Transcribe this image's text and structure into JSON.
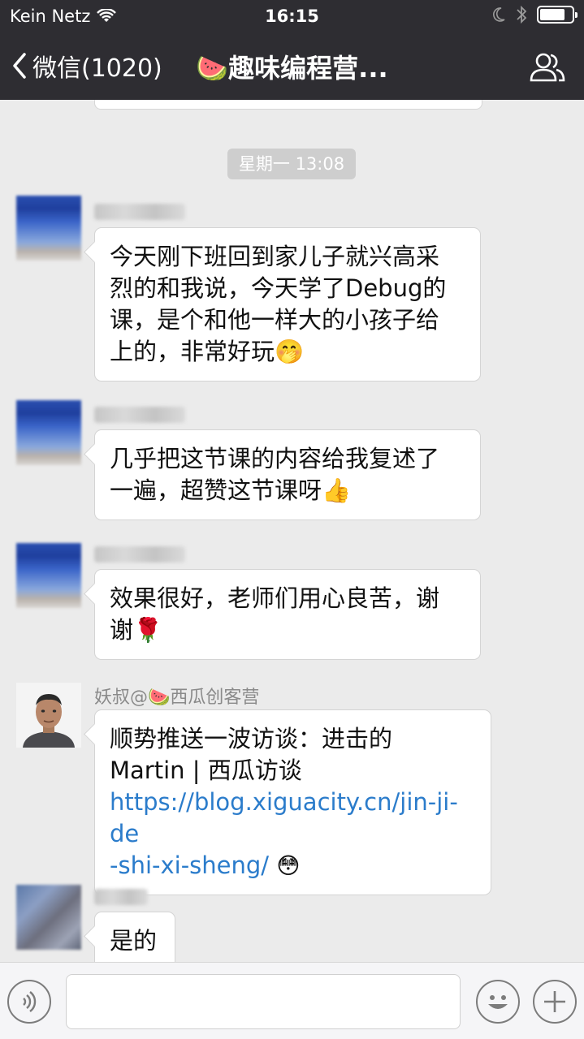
{
  "status_bar": {
    "carrier": "Kein Netz",
    "time": "16:15"
  },
  "nav": {
    "back_label": "微信(1020)",
    "title": "🍉趣味编程营..."
  },
  "chat": {
    "timestamp": "星期一 13:08",
    "messages": [
      {
        "avatar": "pixelated-avatar",
        "sender_blurred": true,
        "lines": [
          "今天刚下班回到家儿子就兴高采",
          "烈的和我说，今天学了Debug的",
          "课，是个和他一样大的小孩子给",
          "上的，非常好玩🤭"
        ]
      },
      {
        "avatar": "pixelated-avatar",
        "sender_blurred": true,
        "lines": [
          "几乎把这节课的内容给我复述了",
          "一遍，超赞这节课呀👍"
        ]
      },
      {
        "avatar": "pixelated-avatar",
        "sender_blurred": true,
        "lines": [
          "效果很好，老师们用心良苦，谢",
          "谢🌹"
        ]
      },
      {
        "avatar": "person-avatar",
        "sender": "妖叔@🍉西瓜创客营",
        "lines": [
          "顺势推送一波访谈：进击的",
          "Martin | 西瓜访谈"
        ],
        "link_lines": [
          "https://blog.xiguacity.cn/jin-ji-de",
          "-shi-xi-sheng/"
        ],
        "link_suffix": "😳"
      },
      {
        "avatar": "pixelated-avatar",
        "sender_blurred": true,
        "lines": [
          "是的"
        ]
      }
    ]
  },
  "input_bar": {
    "voice_icon": "voice-icon",
    "emoji_icon": "emoji-icon",
    "plus_icon": "plus-icon",
    "text_value": ""
  },
  "colors": {
    "nav_bg": "#2e2d32",
    "chat_bg": "#ebebeb",
    "link": "#2b7ccb"
  }
}
